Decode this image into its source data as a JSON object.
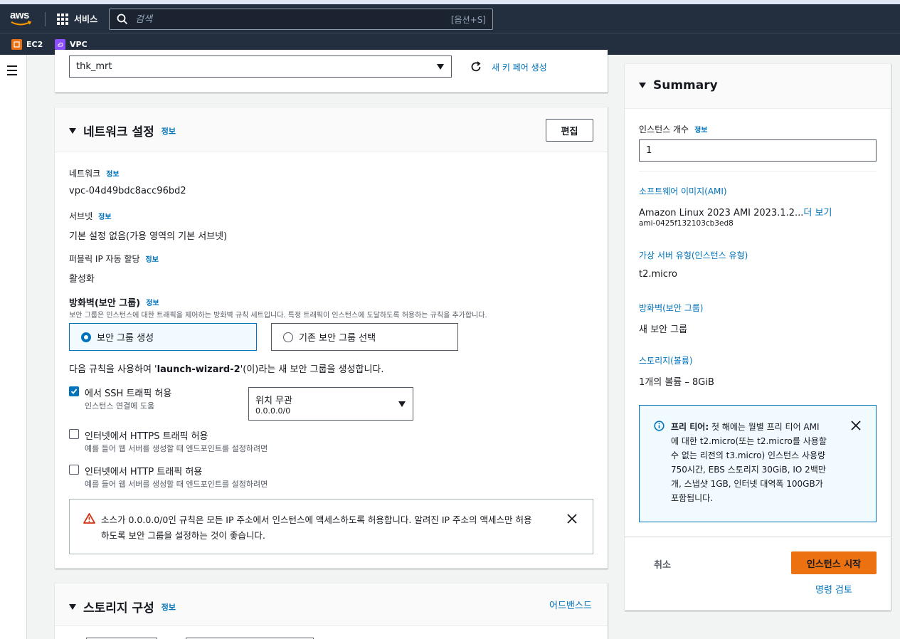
{
  "header": {
    "logo_text": "aws",
    "services_label": "서비스",
    "search_placeholder": "검색",
    "search_shortcut": "[옵션+S]"
  },
  "favorites": [
    {
      "label": "EC2",
      "color": "#ec7211"
    },
    {
      "label": "VPC",
      "color": "#8c4fff"
    }
  ],
  "keypair": {
    "selected": "thk_mrt",
    "create_link": "새 키 페어 생성"
  },
  "network": {
    "title": "네트워크 설정",
    "info": "정보",
    "edit_button": "편집",
    "network_label": "네트워크",
    "network_value": "vpc-04d49bdc8acc96bd2",
    "subnet_label": "서브넷",
    "subnet_value": "기본 설정 없음(가용 영역의 기본 서브넷)",
    "public_ip_label": "퍼블릭 IP 자동 할당",
    "public_ip_value": "활성화",
    "firewall_label": "방화벽(보안 그룹)",
    "firewall_desc": "보안 그룹은 인스턴스에 대한 트래픽을 제어하는 방화벽 규칙 세트입니다. 특정 트래픽이 인스턴스에 도달하도록 허용하는 규칙을 추가합니다.",
    "radio_create": "보안 그룹 생성",
    "radio_existing": "기존 보안 그룹 선택",
    "rule_text_pre": "다음 규칙을 사용하여 '",
    "rule_text_name": "launch-wizard-2",
    "rule_text_post": "'(이)라는 새 보안 그룹을 생성합니다.",
    "ssh_label": "에서 SSH 트래픽 허용",
    "ssh_sub": "인스턴스 연결에 도움",
    "ssh_source_label": "위치 무관",
    "ssh_source_value": "0.0.0.0/0",
    "https_label": "인터넷에서 HTTPS 트래픽 허용",
    "https_sub": "예를 들어 웹 서버를 생성할 때 엔드포인트를 설정하려면",
    "http_label": "인터넷에서 HTTP 트래픽 허용",
    "http_sub": "예를 들어 웹 서버를 생성할 때 엔드포인트를 설정하려면",
    "warning_line1": "소스가 0.0.0.0/0인 규칙은 모든 IP 주소에서 인스턴스에 액세스하도록 허용합니다. 알려진 IP 주소의 액세스만 허용",
    "warning_line2": "하도록 보안 그룹을 설정하는 것이 좋습니다."
  },
  "storage": {
    "title": "스토리지 구성",
    "info": "정보",
    "advanced_link": "어드밴스드"
  },
  "summary": {
    "title": "Summary",
    "count_label": "인스턴스 개수",
    "count_info": "정보",
    "count_value": "1",
    "ami_label": "소프트웨어 이미지(AMI)",
    "ami_value": "Amazon Linux 2023 AMI 2023.1.2...",
    "ami_more": "더 보기",
    "ami_id": "ami-0425f132103cb3ed8",
    "type_label": "가상 서버 유형(인스턴스 유형)",
    "type_value": "t2.micro",
    "firewall_label": "방화벽(보안 그룹)",
    "firewall_value": "새 보안 그룹",
    "storage_label": "스토리지(볼륨)",
    "storage_value": "1개의 볼륨 – 8GiB",
    "free_tier_bold": "프리 티어:",
    "free_tier_lines": [
      " 첫 해에는 월별 프리 티어 AMI",
      "에 대한 t2.micro(또는 t2.micro를 사용할",
      "수 없는 리전의 t3.micro) 인스턴스 사용량",
      "750시간, EBS 스토리지 30GiB, IO 2백만",
      "개, 스냅샷 1GB, 인터넷 대역폭 100GB가",
      "포함됩니다."
    ],
    "cancel_button": "취소",
    "launch_button": "인스턴스 시작",
    "review_link": "명령 검토"
  },
  "colors": {
    "topbar": "#232f3e",
    "link": "#0073bb",
    "primary": "#ec7211",
    "warning": "#d13212"
  }
}
